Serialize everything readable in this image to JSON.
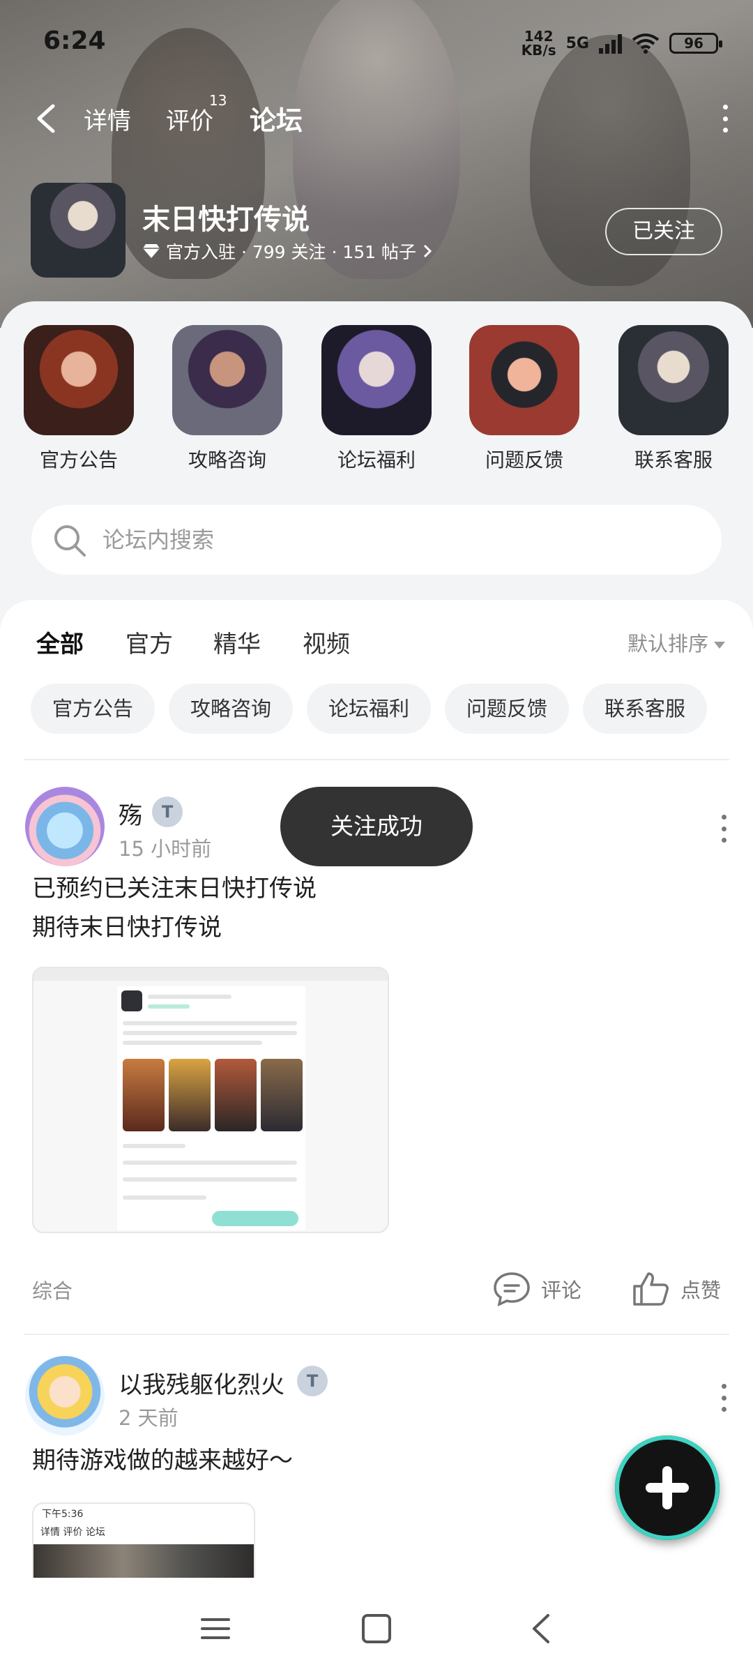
{
  "status_bar": {
    "time": "6:24",
    "net_speed_value": "142",
    "net_speed_unit": "KB/s",
    "signal_type": "5G",
    "wifi_level": "6",
    "battery": "96"
  },
  "nav": {
    "tabs": [
      {
        "label": "详情"
      },
      {
        "label": "评价",
        "badge": "13"
      },
      {
        "label": "论坛",
        "active": true
      }
    ],
    "accent_color": "#3fd3c3"
  },
  "game": {
    "title": "末日快打传说",
    "meta": "官方入驻 · 799 关注 · 151 帖子",
    "follow_label": "已关注"
  },
  "categories": [
    {
      "label": "官方公告"
    },
    {
      "label": "攻略咨询"
    },
    {
      "label": "论坛福利"
    },
    {
      "label": "问题反馈"
    },
    {
      "label": "联系客服"
    }
  ],
  "search": {
    "placeholder": "论坛内搜索"
  },
  "feed_tabs": [
    {
      "label": "全部",
      "active": true
    },
    {
      "label": "官方"
    },
    {
      "label": "精华"
    },
    {
      "label": "视频"
    }
  ],
  "sort_label": "默认排序",
  "chips": [
    "官方公告",
    "攻略咨询",
    "论坛福利",
    "问题反馈",
    "联系客服"
  ],
  "posts": [
    {
      "username": "殇",
      "time": "15 小时前",
      "lines": [
        "已预约已关注末日快打传说",
        "期待末日快打传说"
      ],
      "tag": "综合",
      "comment_label": "评论",
      "like_label": "点赞"
    },
    {
      "username": "以我残躯化烈火",
      "time": "2 天前",
      "lines": [
        "期待游戏做的越来越好～"
      ],
      "screenshot_time": "下午5:36",
      "screenshot_tabs": "详情  评价  论坛"
    }
  ],
  "toast": "关注成功",
  "icons": {
    "back": "back-arrow-icon",
    "more": "more-vertical-icon",
    "search": "search-icon",
    "verified": "diamond-icon",
    "comment": "comment-icon",
    "like": "thumbs-up-icon",
    "fab": "plus-icon"
  }
}
